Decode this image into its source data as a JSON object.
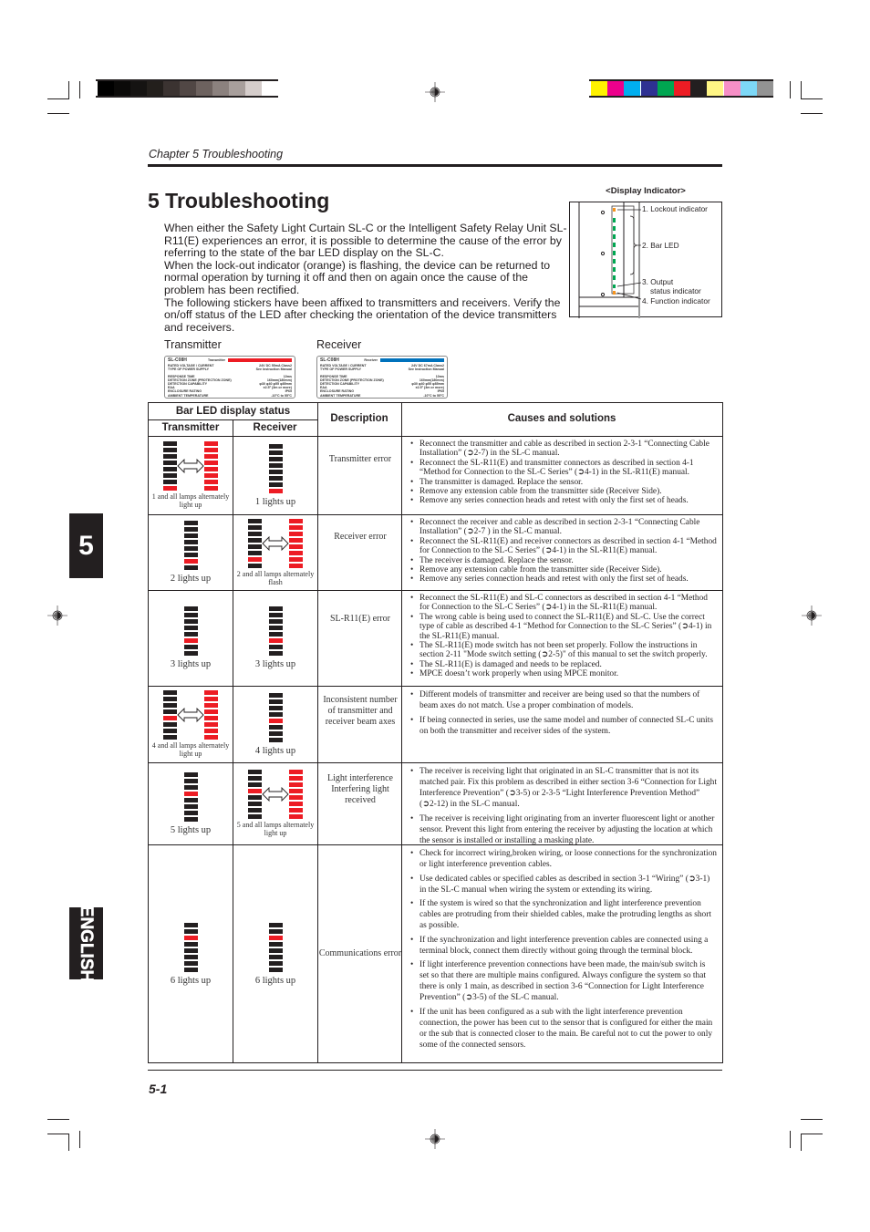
{
  "print_marks": {
    "gray_swatches": [
      "#000000",
      "#0b0a09",
      "#151312",
      "#231f1c",
      "#3b3331",
      "#514745",
      "#6d625f",
      "#8b817e",
      "#a89f9c",
      "#d5cdcb",
      "#ffffff"
    ],
    "color_swatches": [
      "#fff200",
      "#ec008c",
      "#00aeef",
      "#2e3192",
      "#00a651",
      "#ed1c24",
      "#231f20",
      "#fff685",
      "#f68fc6",
      "#7dd8f7",
      "#939393"
    ]
  },
  "header": {
    "chapter": "Chapter 5  Troubleshooting"
  },
  "title": "5 Troubleshooting",
  "intro": [
    "When either the Safety Light Curtain SL-C or the Intelligent Safety Relay Unit SL-R11(E) experiences an error, it is possible to determine the cause of the error by referring to the state of the bar LED display on the SL-C.",
    "When the lock-out indicator (orange) is flashing, the device can be returned to normal operation by turning it off and then on again once the cause of the problem has been rectified.",
    "The following stickers have been affixed to transmitters and receivers. Verify the on/off status of the LED after checking the orientation of the device transmitters and receivers."
  ],
  "stickers": {
    "transmitter_label": "Transmitter",
    "receiver_label": "Receiver",
    "transmitter": {
      "model": "SL-C08H",
      "side": "Transmitter",
      "color": "#ed1c24",
      "rows": [
        [
          "RATED VOLTAGE / CURRENT",
          "24V DC 55mA Class2"
        ],
        [
          "TYPE OF POWER SUPPLY",
          "See Instruction Manual"
        ],
        [
          "RESPONSE TIME",
          "10ms"
        ],
        [
          "DETECTION ZONE (PROTECTION ZONE)",
          "160mm(180mm)"
        ],
        [
          "DETECTION CAPABILITY",
          "φ30 φ40 φ55 φ85mm"
        ],
        [
          "EAA",
          "±2.5° (3m or more)"
        ],
        [
          "ENCLOSURE RATING",
          "IP65"
        ],
        [
          "AMBIENT TEMPERATURE",
          "-10°C to 55°C"
        ]
      ]
    },
    "receiver": {
      "model": "SL-C08H",
      "side": "Receiver",
      "color": "#0072bc",
      "rows": [
        [
          "RATED VOLTAGE / CURRENT",
          "24V DC 67mA Class2"
        ],
        [
          "TYPE OF POWER SUPPLY",
          "See Instruction Manual"
        ],
        [
          "RESPONSE TIME",
          "10ms"
        ],
        [
          "DETECTION ZONE (PROTECTION ZONE)",
          "160mm(180mm)"
        ],
        [
          "DETECTION CAPABILITY",
          "φ30 φ40 φ55 φ85mm"
        ],
        [
          "EAA",
          "±2.5° (3m or more)"
        ],
        [
          "ENCLOSURE RATING",
          "IP65"
        ],
        [
          "AMBIENT TEMPERATURE",
          "-10°C to 55°C"
        ]
      ]
    }
  },
  "display_indicator": {
    "title": "<Display Indicator>",
    "callouts": [
      "1. Lockout indicator",
      "2. Bar LED",
      "3. Output",
      "status indicator",
      "4. Function indicator"
    ],
    "colors": {
      "lockout": "#f7941d",
      "bar": "#00a651",
      "function": "#f7941d"
    }
  },
  "table": {
    "headers": {
      "group": "Bar LED display status",
      "transmitter": "Transmitter",
      "receiver": "Receiver",
      "description": "Description",
      "causes": "Causes and solutions"
    },
    "rows": [
      {
        "tx": {
          "lit": 1,
          "alternate": true,
          "caption": "1 and all lamps alternately light up"
        },
        "rx": {
          "lit": 1,
          "alternate": false,
          "caption": "1 lights up"
        },
        "description": "Transmitter error",
        "causes": [
          "Reconnect the transmitter and cable as described in section 2-3-1 “Connecting Cable Installation” (➲2-7) in the SL-C manual.",
          "Reconnect the SL-R11(E) and transmitter connectors as described in section 4-1 “Method for Connection to the SL-C Series” (➲4-1) in the SL-R11(E) manual.",
          "The transmitter is damaged. Replace the sensor.",
          "Remove any extension cable from the transmitter side (Receiver Side).",
          "Remove any series connection heads and retest with only the first set of heads."
        ]
      },
      {
        "tx": {
          "lit": 2,
          "alternate": false,
          "caption": "2 lights up"
        },
        "rx": {
          "lit": 2,
          "alternate": true,
          "caption": "2 and all lamps alternately flash"
        },
        "description": "Receiver error",
        "causes": [
          "Reconnect the receiver and cable as described in section 2-3-1 “Connecting Cable Installation” (➲2-7 ) in the SL-C manual.",
          "Reconnect the SL-R11(E) and receiver connectors as described in section 4-1 “Method for Connection to the SL-C Series” (➲4-1) in the SL-R11(E) manual.",
          "The receiver is damaged. Replace the sensor.",
          "Remove any extension cable from the transmitter side (Receiver Side).",
          "Remove any series connection heads and retest with only the first set of heads."
        ]
      },
      {
        "tx": {
          "lit": 3,
          "alternate": false,
          "caption": "3 lights up"
        },
        "rx": {
          "lit": 3,
          "alternate": false,
          "caption": "3 lights up"
        },
        "description": "SL-R11(E) error",
        "causes": [
          "Reconnect the SL-R11(E) and SL-C connectors as described in section 4-1 “Method for Connection to the SL-C Series” (➲4-1) in the SL-R11(E) manual.",
          "The wrong cable is being used to connect the SL-R11(E) and SL-C. Use the correct type of cable as described 4-1 “Method for Connection to the SL-C Series” (➲4-1) in the SL-R11(E) manual.",
          "The SL-R11(E) mode switch has not been set properly. Follow the instructions in section 2-11 \"Mode switch setting (➲2-5)\" of this manual to set the switch properly.",
          "The SL-R11(E) is damaged and needs to be replaced.",
          "MPCE doesn’t work properly when using MPCE monitor."
        ]
      },
      {
        "tx": {
          "lit": 4,
          "alternate": true,
          "caption": "4 and all lamps alternately light up"
        },
        "rx": {
          "lit": 4,
          "alternate": false,
          "caption": "4 lights up"
        },
        "description": "Inconsistent number of transmitter and receiver beam axes",
        "causes": [
          "Different models of transmitter and receiver are being used so that the numbers of beam axes do not match. Use a proper combination of models.",
          "If being connected in series, use the same model and number of connected SL-C units on both the transmitter and receiver sides of the system."
        ]
      },
      {
        "tx": {
          "lit": 5,
          "alternate": false,
          "caption": "5 lights up"
        },
        "rx": {
          "lit": 5,
          "alternate": true,
          "caption": "5 and all lamps alternately light up"
        },
        "description": "Light interference Interfering light  received",
        "causes": [
          "The receiver is receiving light that originated in an SL-C transmitter that is not its matched pair. Fix this problem as described in either section 3-6 “Connection for Light Interference Prevention” (➲3-5) or 2-3-5 “Light Interference Prevention Method”  (➲2-12) in the SL-C manual.",
          "The receiver is receiving light originating from an inverter fluorescent light or another sensor. Prevent this light from entering the receiver by adjusting the location at which the sensor is installed or installing a masking plate."
        ]
      },
      {
        "tx": {
          "lit": 6,
          "alternate": false,
          "caption": "6 lights up"
        },
        "rx": {
          "lit": 6,
          "alternate": false,
          "caption": "6 lights up"
        },
        "description": "Communications error",
        "causes": [
          "Check for incorrect wiring,broken wiring, or loose connections for the synchronization or light interference prevention cables.",
          "Use dedicated cables or specified cables as described in section 3-1 “Wiring” (➲3-1) in the SL-C manual when wiring the system or extending its wiring.",
          "If the system is wired so that the synchronization and light interference prevention cables are protruding from their shielded cables, make the protruding lengths as short as possible.",
          "If the synchronization and light interference prevention cables are connected using a terminal block, connect them directly without going through the terminal block.",
          "If light interference prevention connections have been made, the main/sub switch is set so that there are multiple mains configured. Always configure the system so that there is only 1 main, as described in section 3-6 “Connection for Light Interference Prevention” (➲3-5) of the SL-C manual.",
          "If the unit has been configured as a sub with the light interference prevention connection, the power has been cut to the sensor that is configured for either the main or the sub that is connected closer to the main. Be careful not to cut the power to only some of the connected sensors."
        ]
      }
    ]
  },
  "side_tabs": {
    "chapter_number": "5",
    "language": "ENGLISH"
  },
  "footer": {
    "page_number": "5-1"
  }
}
